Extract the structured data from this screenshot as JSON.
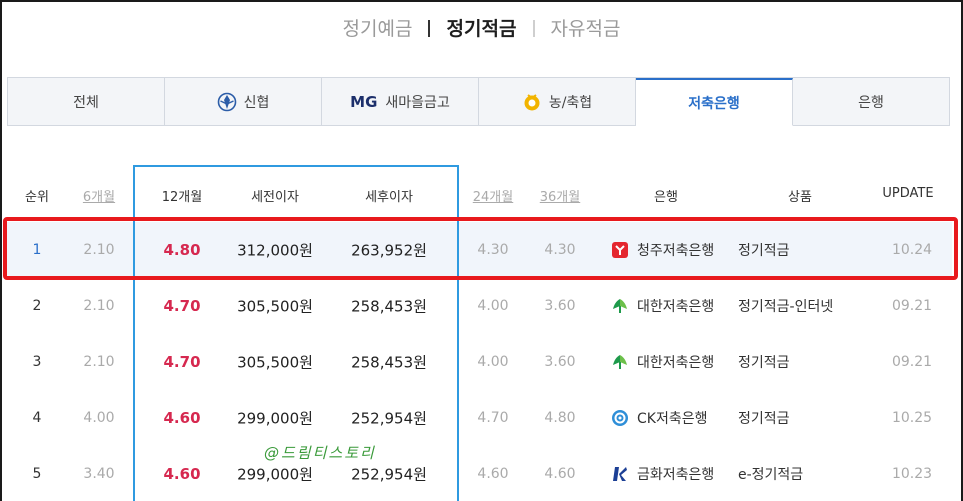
{
  "category_tabs": [
    {
      "label": "정기예금",
      "active": false
    },
    {
      "label": "정기적금",
      "active": true
    },
    {
      "label": "자유적금",
      "active": false
    }
  ],
  "bank_tabs": [
    {
      "label": "전체",
      "icon": "",
      "active": false
    },
    {
      "label": "신협",
      "icon": "shinhyup-logo-icon",
      "active": false
    },
    {
      "label": "새마을금고",
      "icon": "mg-logo-icon",
      "mark": "MG",
      "active": false
    },
    {
      "label": "농/축협",
      "icon": "nonghyup-logo-icon",
      "active": false
    },
    {
      "label": "저축은행",
      "icon": "",
      "active": true
    },
    {
      "label": "은행",
      "icon": "",
      "active": false
    }
  ],
  "table": {
    "headers": {
      "rank": "순위",
      "m6": "6개월",
      "m12": "12개월",
      "pre_tax": "세전이자",
      "post_tax": "세후이자",
      "m24": "24개월",
      "m36": "36개월",
      "bank": "은행",
      "product": "상품",
      "update": "UPDATE"
    },
    "rows": [
      {
        "rank": "1",
        "m6": "2.10",
        "m12": "4.80",
        "pre_tax": "312,000원",
        "post_tax": "263,952원",
        "m24": "4.30",
        "m36": "4.30",
        "bank": "청주저축은행",
        "bank_icon": "cheongju-bank-icon",
        "product": "정기적금",
        "update": "10.24"
      },
      {
        "rank": "2",
        "m6": "2.10",
        "m12": "4.70",
        "pre_tax": "305,500원",
        "post_tax": "258,453원",
        "m24": "4.00",
        "m36": "3.60",
        "bank": "대한저축은행",
        "bank_icon": "daehan-bank-icon",
        "product": "정기적금-인터넷",
        "update": "09.21"
      },
      {
        "rank": "3",
        "m6": "2.10",
        "m12": "4.70",
        "pre_tax": "305,500원",
        "post_tax": "258,453원",
        "m24": "4.00",
        "m36": "3.60",
        "bank": "대한저축은행",
        "bank_icon": "daehan-bank-icon",
        "product": "정기적금",
        "update": "09.21"
      },
      {
        "rank": "4",
        "m6": "4.00",
        "m12": "4.60",
        "pre_tax": "299,000원",
        "post_tax": "252,954원",
        "m24": "4.70",
        "m36": "4.80",
        "bank": "CK저축은행",
        "bank_icon": "ck-bank-icon",
        "product": "정기적금",
        "update": "10.25"
      },
      {
        "rank": "5",
        "m6": "3.40",
        "m12": "4.60",
        "pre_tax": "299,000원",
        "post_tax": "252,954원",
        "m24": "4.60",
        "m36": "4.60",
        "bank": "금화저축은행",
        "bank_icon": "geumhwa-bank-icon",
        "product": "e-정기적금",
        "update": "10.23"
      }
    ]
  },
  "watermark": "@드림티스토리",
  "colors": {
    "accent_blue": "#2a6fc9",
    "rate_red": "#d6284f",
    "highlight_red": "#e8191d",
    "column_highlight_blue": "#2f9ae0"
  }
}
